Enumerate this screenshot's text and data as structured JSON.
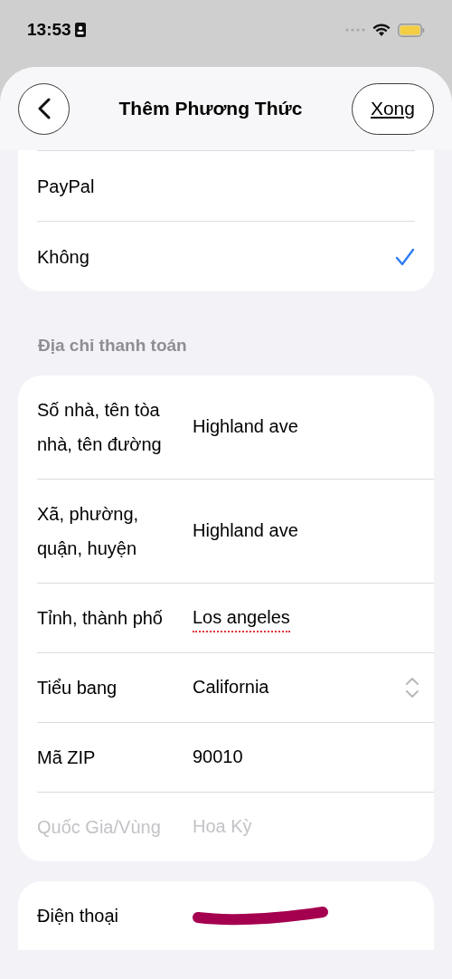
{
  "status_bar": {
    "time": "13:53"
  },
  "header": {
    "title": "Thêm Phương Thức",
    "done": "Xong"
  },
  "payment_options": [
    {
      "label": "PayPal",
      "selected": false
    },
    {
      "label": "Không",
      "selected": true
    }
  ],
  "billing_address": {
    "heading": "Địa chỉ thanh toán",
    "fields": [
      {
        "kind": "text",
        "label": "Số nhà, tên tòa nhà, tên đường",
        "value": "Highland ave",
        "disabled": false,
        "misspelled": false
      },
      {
        "kind": "text",
        "label": "Xã, phường, quận, huyện",
        "value": "Highland ave",
        "disabled": false,
        "misspelled": false
      },
      {
        "kind": "text",
        "label": "Tỉnh, thành phố",
        "value": "Los angeles",
        "disabled": false,
        "misspelled": true
      },
      {
        "kind": "picker",
        "label": "Tiểu bang",
        "value": "California",
        "disabled": false,
        "misspelled": false
      },
      {
        "kind": "text",
        "label": "Mã ZIP",
        "value": "90010",
        "disabled": false,
        "misspelled": false
      },
      {
        "kind": "text",
        "label": "Quốc Gia/Vùng",
        "value": "Hoa Kỳ",
        "disabled": true,
        "misspelled": false
      }
    ]
  },
  "contact": [
    {
      "kind": "redacted",
      "label": "Điện thoại"
    }
  ]
}
